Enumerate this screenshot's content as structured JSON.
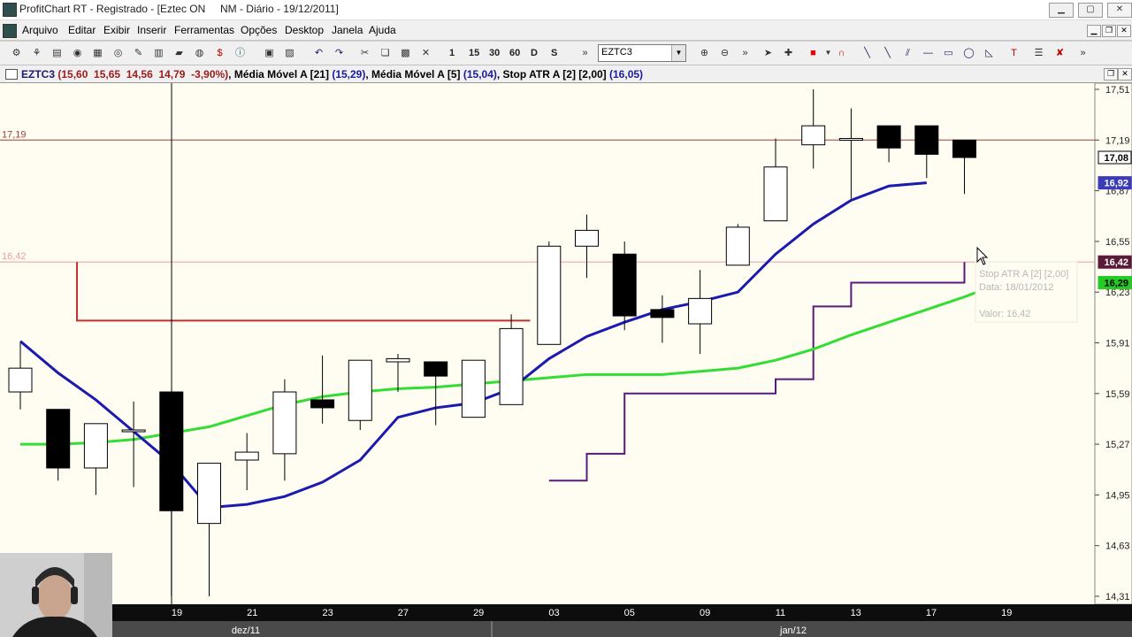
{
  "window": {
    "title": "ProfitChart RT - Registrado - [Eztec ON     NM - Diário - 19/12/2011]",
    "min": "▁",
    "max": "▢",
    "close": "✕"
  },
  "menu": [
    "Arquivo",
    "Editar",
    "Exibir",
    "Inserir",
    "Ferramentas",
    "Opções",
    "Desktop",
    "Janela",
    "Ajuda"
  ],
  "toolbar": {
    "intervals": [
      "1",
      "15",
      "30",
      "60",
      "D",
      "S"
    ],
    "symbol": "EZTC3"
  },
  "info": {
    "symbol": "EZTC3",
    "ohlc": "(15,60  15,65  14,56  14,79  -3,90%)",
    "ma21_label": "Média Móvel A [21]",
    "ma21_value": "(15,29)",
    "ma5_label": "Média Móvel A [5]",
    "ma5_value": "(15,04)",
    "atr_label": "Stop ATR A [2] [2,00]",
    "atr_value": "(16,05)"
  },
  "chart_data": {
    "type": "candlestick",
    "y_axis_ticks": [
      "17,51",
      "17,19",
      "16,87",
      "16,55",
      "16,23",
      "15,91",
      "15,59",
      "15,27",
      "14,95",
      "14,63",
      "14,31"
    ],
    "x_axis_ticks": [
      "19",
      "21",
      "23",
      "27",
      "29",
      "03",
      "05",
      "09",
      "11",
      "13",
      "17",
      "19"
    ],
    "month_labels": [
      "dez/11",
      "jan/12"
    ],
    "price_tags": {
      "last": "17,08",
      "ma5": "16,92",
      "stop": "16,42",
      "ma21": "16,29"
    },
    "hlines": [
      {
        "label": "17,19",
        "value": 17.19,
        "color": "#a04040"
      },
      {
        "label": "16,42",
        "value": 16.42,
        "color": "#e8a0a0"
      }
    ],
    "tooltip": {
      "line1": "Stop ATR A [2] [2,00]",
      "line2": "Data: 18/01/2012",
      "line3": "Valor: 16,42"
    },
    "candles": [
      {
        "o": 15.6,
        "h": 15.91,
        "l": 15.49,
        "c": 15.75
      },
      {
        "o": 15.49,
        "h": 15.49,
        "l": 15.04,
        "c": 15.12
      },
      {
        "o": 15.12,
        "h": 15.4,
        "l": 14.95,
        "c": 15.4
      },
      {
        "o": 15.36,
        "h": 15.54,
        "l": 15.0,
        "c": 15.36
      },
      {
        "o": 15.6,
        "h": 15.6,
        "l": 14.31,
        "c": 14.85
      },
      {
        "o": 14.77,
        "h": 14.85,
        "l": 14.31,
        "c": 15.15
      },
      {
        "o": 15.17,
        "h": 15.34,
        "l": 14.98,
        "c": 15.22
      },
      {
        "o": 15.21,
        "h": 15.68,
        "l": 15.04,
        "c": 15.6
      },
      {
        "o": 15.55,
        "h": 15.83,
        "l": 15.4,
        "c": 15.5
      },
      {
        "o": 15.42,
        "h": 15.75,
        "l": 15.36,
        "c": 15.8
      },
      {
        "o": 15.79,
        "h": 15.84,
        "l": 15.6,
        "c": 15.81
      },
      {
        "o": 15.79,
        "h": 15.79,
        "l": 15.39,
        "c": 15.7
      },
      {
        "o": 15.44,
        "h": 15.77,
        "l": 15.44,
        "c": 15.8
      },
      {
        "o": 15.52,
        "h": 16.09,
        "l": 15.52,
        "c": 16.0
      },
      {
        "o": 15.9,
        "h": 16.55,
        "l": 15.9,
        "c": 16.52
      },
      {
        "o": 16.52,
        "h": 16.72,
        "l": 16.32,
        "c": 16.62
      },
      {
        "o": 16.47,
        "h": 16.55,
        "l": 15.99,
        "c": 16.08
      },
      {
        "o": 16.12,
        "h": 16.21,
        "l": 15.91,
        "c": 16.07
      },
      {
        "o": 16.03,
        "h": 16.37,
        "l": 15.84,
        "c": 16.19
      },
      {
        "o": 16.4,
        "h": 16.66,
        "l": 16.4,
        "c": 16.64
      },
      {
        "o": 16.68,
        "h": 17.2,
        "l": 16.68,
        "c": 17.02
      },
      {
        "o": 17.16,
        "h": 17.51,
        "l": 17.01,
        "c": 17.28
      },
      {
        "o": 17.19,
        "h": 17.39,
        "l": 16.82,
        "c": 17.2
      },
      {
        "o": 17.28,
        "h": 17.28,
        "l": 17.05,
        "c": 17.14
      },
      {
        "o": 17.28,
        "h": 17.28,
        "l": 16.95,
        "c": 17.1
      },
      {
        "o": 17.19,
        "h": 17.19,
        "l": 16.85,
        "c": 17.08
      }
    ],
    "ma5": [
      15.92,
      15.72,
      15.55,
      15.35,
      15.15,
      14.87,
      14.89,
      14.94,
      15.03,
      15.17,
      15.44,
      15.5,
      15.53,
      15.62,
      15.81,
      15.95,
      16.04,
      16.12,
      16.17,
      16.23,
      16.47,
      16.66,
      16.81,
      16.9,
      16.92
    ],
    "ma21": [
      15.27,
      15.27,
      15.28,
      15.3,
      15.34,
      15.38,
      15.45,
      15.52,
      15.57,
      15.6,
      15.62,
      15.63,
      15.65,
      15.67,
      15.69,
      15.71,
      15.71,
      15.71,
      15.73,
      15.75,
      15.8,
      15.87,
      15.96,
      16.04,
      16.12,
      16.2,
      16.29
    ],
    "stop_atr": [
      {
        "i": 1.5,
        "v": 16.42
      },
      {
        "i": 14,
        "v": 16.42
      },
      {
        "i": 14,
        "v": 15.04
      },
      {
        "i": 15,
        "v": 15.04
      },
      {
        "i": 15,
        "v": 15.21
      },
      {
        "i": 16,
        "v": 15.21
      },
      {
        "i": 16,
        "v": 15.59
      },
      {
        "i": 20,
        "v": 15.59
      },
      {
        "i": 20,
        "v": 15.68
      },
      {
        "i": 21,
        "v": 15.68
      },
      {
        "i": 21,
        "v": 16.14
      },
      {
        "i": 22,
        "v": 16.14
      },
      {
        "i": 22,
        "v": 16.29
      },
      {
        "i": 25,
        "v": 16.29
      },
      {
        "i": 25,
        "v": 16.42
      }
    ]
  }
}
